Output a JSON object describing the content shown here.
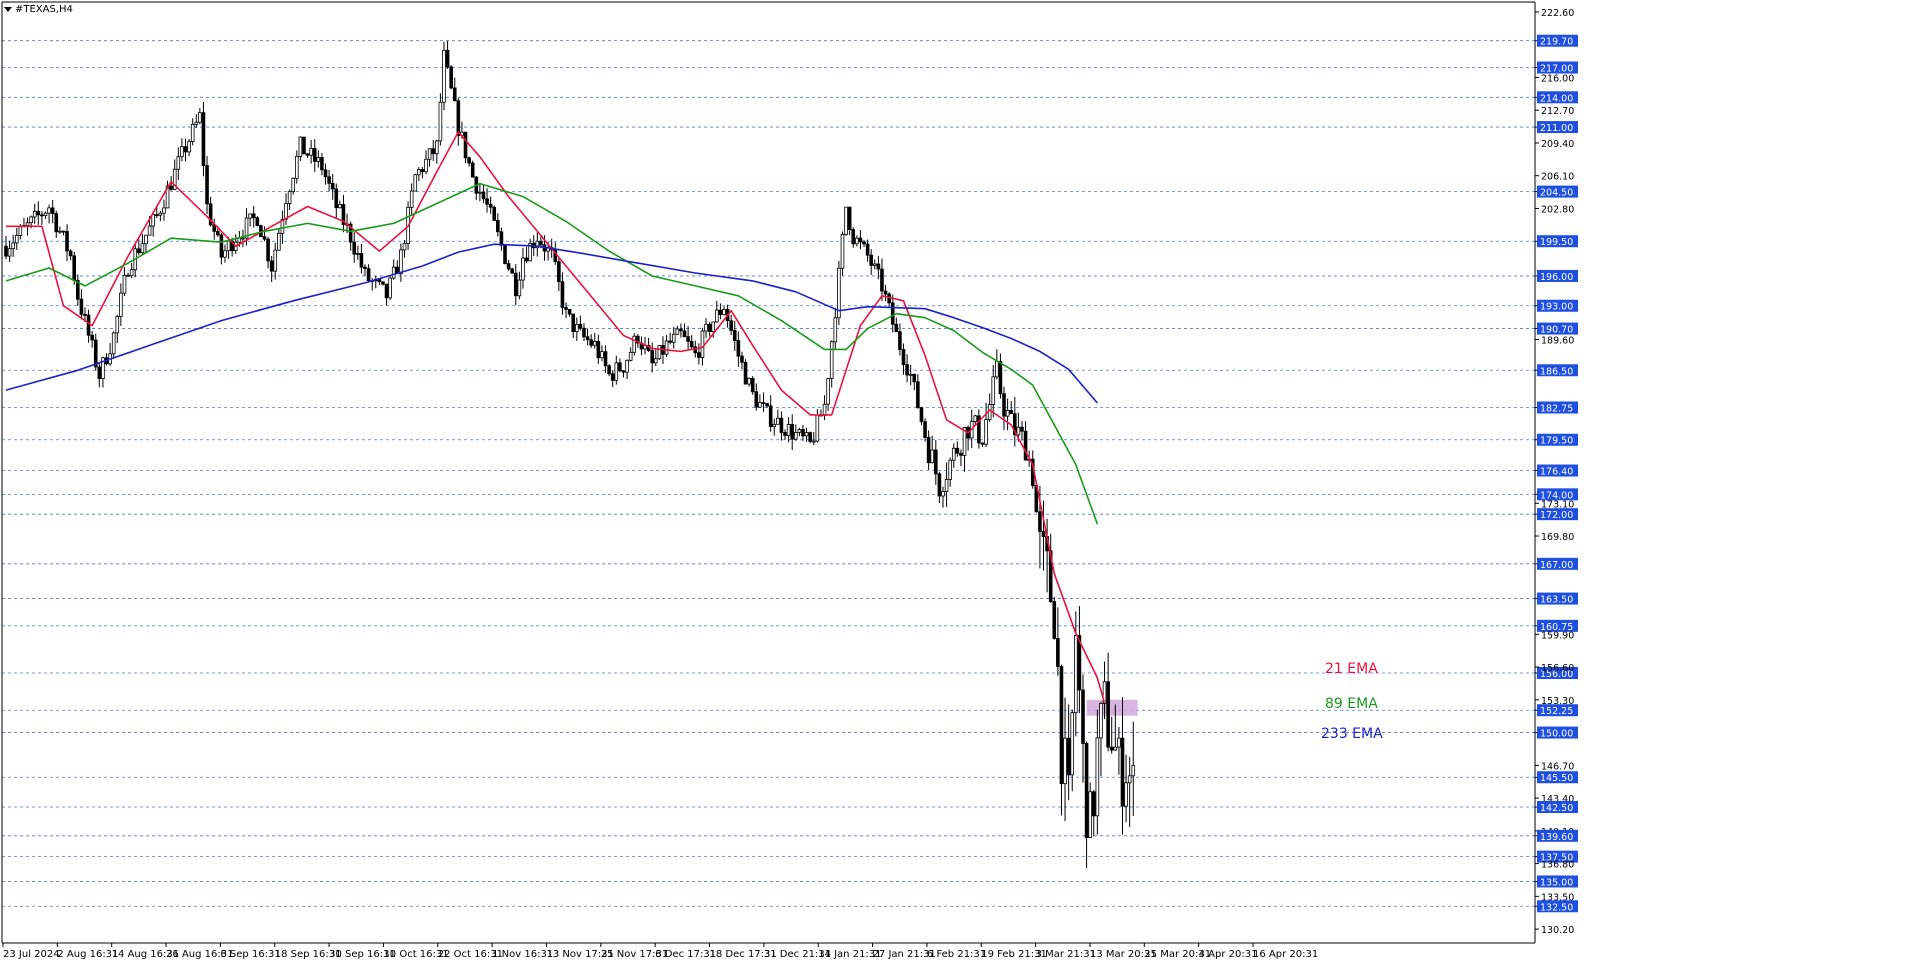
{
  "window": {
    "symbol_title": "#TEXAS,H4"
  },
  "colors": {
    "background": "#ffffff",
    "grid": "#2f5fd0",
    "price_tag_bg": "#1f4fe0",
    "price_tag_text": "#ffffff",
    "candle": "#000000",
    "ema21": "#e8143c",
    "ema89": "#1a9a1a",
    "ema233": "#1a22c8",
    "zone": "#cda2d8"
  },
  "chart_data": {
    "type": "candlestick",
    "title": "",
    "ylim": [
      128.8,
      223.6
    ],
    "grid_levels": [
      219.7,
      217.0,
      214.0,
      211.0,
      204.5,
      199.5,
      196.0,
      193.0,
      190.7,
      186.5,
      182.75,
      179.5,
      176.4,
      174.0,
      172.0,
      167.0,
      163.5,
      160.75,
      156.0,
      152.25,
      150.0,
      145.5,
      142.5,
      139.6,
      137.5,
      135.0,
      132.5
    ],
    "y_ticks": [
      "222.60",
      "219.70",
      "217.00",
      "216.00",
      "214.00",
      "212.70",
      "211.00",
      "209.40",
      "206.10",
      "204.50",
      "202.80",
      "199.50",
      "196.00",
      "193.00",
      "190.70",
      "189.60",
      "186.50",
      "182.75",
      "179.50",
      "176.40",
      "174.00",
      "173.10",
      "172.00",
      "169.80",
      "167.00",
      "163.50",
      "160.75",
      "159.90",
      "156.00",
      "156.60",
      "153.30",
      "152.25",
      "150.00",
      "146.70",
      "145.50",
      "143.40",
      "142.50",
      "140.10",
      "139.60",
      "137.50",
      "136.80",
      "135.00",
      "133.50",
      "132.50",
      "130.20"
    ],
    "highlighted_ticks": [
      "219.70",
      "217.00",
      "214.00",
      "211.00",
      "204.50",
      "199.50",
      "196.00",
      "193.00",
      "190.70",
      "186.50",
      "182.75",
      "179.50",
      "176.40",
      "174.00",
      "172.00",
      "167.00",
      "163.50",
      "160.75",
      "156.00",
      "152.25",
      "150.00",
      "145.50",
      "142.50",
      "139.60",
      "137.50",
      "135.00",
      "132.50"
    ],
    "x_tick_labels": [
      "23 Jul 2024",
      "2 Aug 16:31",
      "14 Aug 16:31",
      "26 Aug 16:31",
      "6 Sep 16:31",
      "18 Sep 16:31",
      "30 Sep 16:31",
      "10 Oct 16:31",
      "22 Oct 16:31",
      "1 Nov 16:31",
      "13 Nov 17:31",
      "25 Nov 17:31",
      "6 Dec 17:31",
      "18 Dec 17:31",
      "31 Dec 21:31",
      "14 Jan 21:31",
      "27 Jan 21:31",
      "6 Feb 21:31",
      "19 Feb 21:31",
      "3 Mar 21:31",
      "13 Mar 20:31",
      "25 Mar 20:31",
      "4 Apr 20:31",
      "16 Apr 20:31"
    ],
    "price_path": [
      [
        0,
        199
      ],
      [
        6,
        203
      ],
      [
        9,
        198
      ],
      [
        10,
        194
      ],
      [
        13,
        186
      ],
      [
        15,
        190
      ],
      [
        17,
        197
      ],
      [
        21,
        202
      ],
      [
        25,
        209
      ],
      [
        27,
        212
      ],
      [
        28,
        203
      ],
      [
        30,
        198
      ],
      [
        32,
        200
      ],
      [
        35,
        202
      ],
      [
        37,
        197
      ],
      [
        39,
        204
      ],
      [
        41,
        209
      ],
      [
        44,
        207
      ],
      [
        46,
        203
      ],
      [
        48,
        200
      ],
      [
        50,
        196
      ],
      [
        53,
        194
      ],
      [
        55,
        198
      ],
      [
        57,
        206
      ],
      [
        60,
        209
      ],
      [
        61,
        218
      ],
      [
        63,
        211
      ],
      [
        65,
        206
      ],
      [
        67,
        203
      ],
      [
        69,
        199
      ],
      [
        71,
        195
      ],
      [
        72,
        198
      ],
      [
        74,
        200
      ],
      [
        76,
        198
      ],
      [
        78,
        192
      ],
      [
        80,
        190
      ],
      [
        82,
        189
      ],
      [
        84,
        186
      ],
      [
        86,
        187
      ],
      [
        88,
        190
      ],
      [
        90,
        187
      ],
      [
        92,
        189
      ],
      [
        94,
        190
      ],
      [
        96,
        188
      ],
      [
        98,
        191
      ],
      [
        100,
        193
      ],
      [
        102,
        188
      ],
      [
        104,
        184
      ],
      [
        106,
        182
      ],
      [
        108,
        181
      ],
      [
        110,
        180
      ],
      [
        112,
        179
      ],
      [
        114,
        183
      ],
      [
        116,
        196
      ],
      [
        117,
        203
      ],
      [
        118,
        200
      ],
      [
        120,
        198
      ],
      [
        122,
        195
      ],
      [
        124,
        190
      ],
      [
        126,
        186
      ],
      [
        128,
        180
      ],
      [
        130,
        175
      ],
      [
        132,
        178
      ],
      [
        134,
        181
      ],
      [
        136,
        180
      ],
      [
        138,
        186
      ],
      [
        139,
        183
      ],
      [
        140,
        181
      ],
      [
        142,
        179
      ],
      [
        143,
        176
      ],
      [
        144,
        168
      ],
      [
        146,
        163
      ],
      [
        147,
        149
      ],
      [
        148,
        142
      ],
      [
        149,
        160
      ],
      [
        150,
        147
      ],
      [
        151,
        140
      ],
      [
        152,
        148
      ],
      [
        153,
        152
      ],
      [
        154,
        150
      ],
      [
        155,
        146
      ],
      [
        156,
        147
      ],
      [
        157,
        144
      ]
    ],
    "series": [
      {
        "name": "21 EMA",
        "color": "#e8143c",
        "points": [
          [
            0,
            201
          ],
          [
            5,
            201
          ],
          [
            8,
            193
          ],
          [
            12,
            191
          ],
          [
            17,
            198
          ],
          [
            23,
            205.5
          ],
          [
            28,
            202
          ],
          [
            32,
            199
          ],
          [
            37,
            201
          ],
          [
            42,
            203
          ],
          [
            47,
            201.5
          ],
          [
            52,
            198.5
          ],
          [
            56,
            201
          ],
          [
            60,
            206.5
          ],
          [
            63,
            210.5
          ],
          [
            66,
            208
          ],
          [
            70,
            204
          ],
          [
            74,
            200.5
          ],
          [
            78,
            197
          ],
          [
            82,
            193.5
          ],
          [
            86,
            190
          ],
          [
            90,
            188.7
          ],
          [
            94,
            188.4
          ],
          [
            97,
            188.8
          ],
          [
            101,
            192.5
          ],
          [
            104,
            189
          ],
          [
            108,
            184.5
          ],
          [
            112,
            182
          ],
          [
            115,
            182
          ],
          [
            119,
            191
          ],
          [
            122,
            194
          ],
          [
            125,
            193.5
          ],
          [
            128,
            188
          ],
          [
            131,
            181.5
          ],
          [
            134,
            180.2
          ],
          [
            137,
            182.5
          ],
          [
            140,
            181
          ],
          [
            143,
            177
          ],
          [
            146,
            166
          ],
          [
            149,
            160
          ],
          [
            152,
            155.5
          ],
          [
            153,
            153
          ]
        ]
      },
      {
        "name": "89 EMA",
        "color": "#1a9a1a",
        "points": [
          [
            0,
            195.5
          ],
          [
            6,
            196.8
          ],
          [
            11,
            195
          ],
          [
            17,
            197.3
          ],
          [
            23,
            199.8
          ],
          [
            30,
            199.4
          ],
          [
            36,
            200.5
          ],
          [
            42,
            201.3
          ],
          [
            48,
            200.5
          ],
          [
            54,
            201.3
          ],
          [
            60,
            203.3
          ],
          [
            66,
            205.3
          ],
          [
            72,
            204
          ],
          [
            78,
            201.5
          ],
          [
            84,
            198.5
          ],
          [
            90,
            196
          ],
          [
            96,
            195
          ],
          [
            102,
            194
          ],
          [
            108,
            191.5
          ],
          [
            114,
            188.6
          ],
          [
            117,
            188.6
          ],
          [
            120,
            190.7
          ],
          [
            124,
            192.2
          ],
          [
            128,
            191.8
          ],
          [
            132,
            190.5
          ],
          [
            136,
            188.3
          ],
          [
            140,
            186.6
          ],
          [
            143,
            185
          ],
          [
            146,
            181
          ],
          [
            149,
            177
          ],
          [
            152,
            171
          ]
        ]
      },
      {
        "name": "233 EMA",
        "color": "#1a22c8",
        "points": [
          [
            0,
            184.5
          ],
          [
            10,
            186.5
          ],
          [
            20,
            189
          ],
          [
            30,
            191.5
          ],
          [
            40,
            193.5
          ],
          [
            50,
            195.3
          ],
          [
            58,
            197
          ],
          [
            63,
            198.4
          ],
          [
            68,
            199.2
          ],
          [
            74,
            199
          ],
          [
            80,
            198.3
          ],
          [
            88,
            197.3
          ],
          [
            96,
            196.3
          ],
          [
            104,
            195.5
          ],
          [
            110,
            194.4
          ],
          [
            116,
            192.5
          ],
          [
            120,
            192.9
          ],
          [
            124,
            192.8
          ],
          [
            128,
            192.7
          ],
          [
            132,
            191.8
          ],
          [
            136,
            190.8
          ],
          [
            140,
            189.7
          ],
          [
            144,
            188.4
          ],
          [
            148,
            186.6
          ],
          [
            152,
            183.2
          ]
        ]
      }
    ],
    "legend": [
      "21 EMA",
      "89 EMA",
      "233 EMA"
    ],
    "zone": {
      "low": 151.7,
      "high": 153.3
    }
  }
}
